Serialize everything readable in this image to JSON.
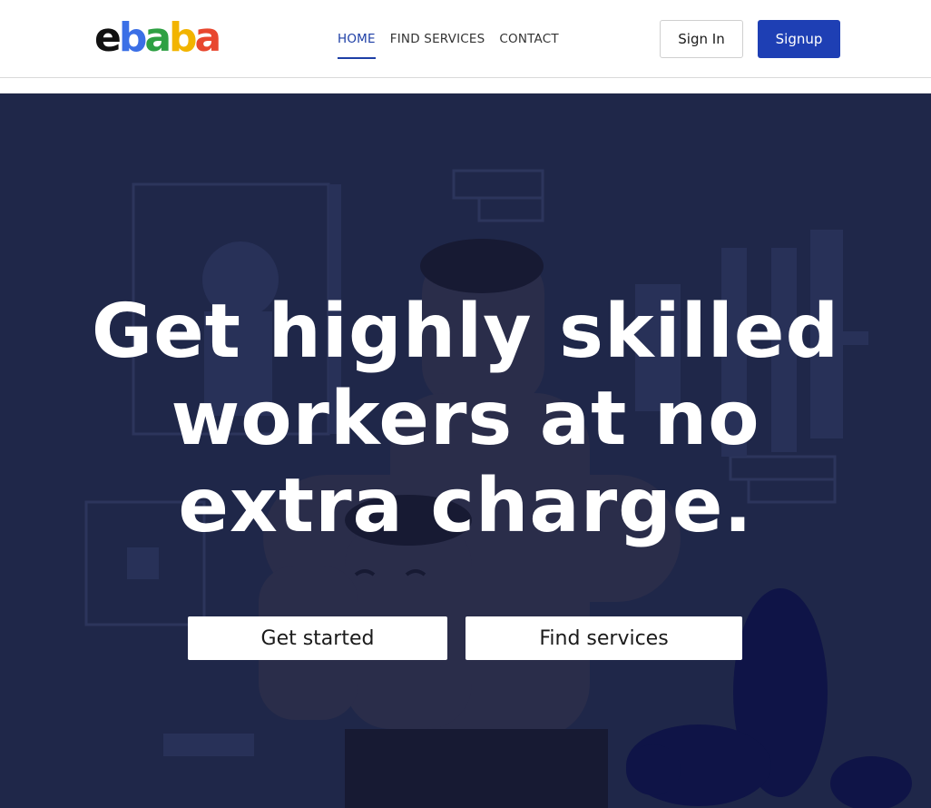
{
  "header": {
    "logo": [
      "e",
      "b",
      "a",
      "b",
      "a"
    ],
    "logo_colors": [
      "#111111",
      "#3b6fe6",
      "#2ea043",
      "#f2b400",
      "#e8472f"
    ],
    "nav": [
      {
        "label": "HOME",
        "active": true
      },
      {
        "label": "FIND SERVICES",
        "active": false
      },
      {
        "label": "CONTACT",
        "active": false
      }
    ],
    "signin_label": "Sign In",
    "signup_label": "Signup"
  },
  "hero": {
    "headline": [
      "Get highly skilled",
      "workers at no",
      "extra charge."
    ],
    "cta_start_label": "Get started",
    "cta_find_label": "Find services",
    "background_color": "#1f2749"
  }
}
